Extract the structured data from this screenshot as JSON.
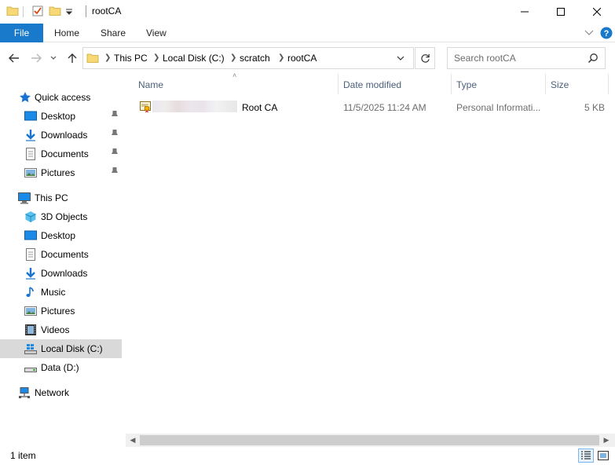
{
  "window": {
    "title": "rootCA"
  },
  "ribbon": {
    "tabs": [
      "File",
      "Home",
      "Share",
      "View"
    ]
  },
  "address": {
    "segments": [
      "This PC",
      "Local Disk (C:)",
      "scratch",
      "rootCA"
    ]
  },
  "search": {
    "placeholder": "Search rootCA"
  },
  "sidebar": {
    "quick_access": {
      "label": "Quick access",
      "items": [
        "Desktop",
        "Downloads",
        "Documents",
        "Pictures"
      ]
    },
    "this_pc": {
      "label": "This PC",
      "items": [
        "3D Objects",
        "Desktop",
        "Documents",
        "Downloads",
        "Music",
        "Pictures",
        "Videos",
        "Local Disk (C:)",
        "Data (D:)"
      ]
    },
    "network": {
      "label": "Network"
    },
    "selected": "Local Disk (C:)"
  },
  "columns": {
    "name": "Name",
    "date": "Date modified",
    "type": "Type",
    "size": "Size"
  },
  "files": [
    {
      "name": "Root CA",
      "date": "11/5/2025 11:24 AM",
      "type": "Personal Informati...",
      "size": "5 KB"
    }
  ],
  "status": {
    "count": "1 item"
  },
  "colors": {
    "accent": "#1979ca",
    "folder": "#f8d775",
    "selected_bg": "#d9d9d9"
  },
  "icons": {
    "app": "folder-icon",
    "quick_access": "star-icon",
    "file": "certificate-icon"
  }
}
